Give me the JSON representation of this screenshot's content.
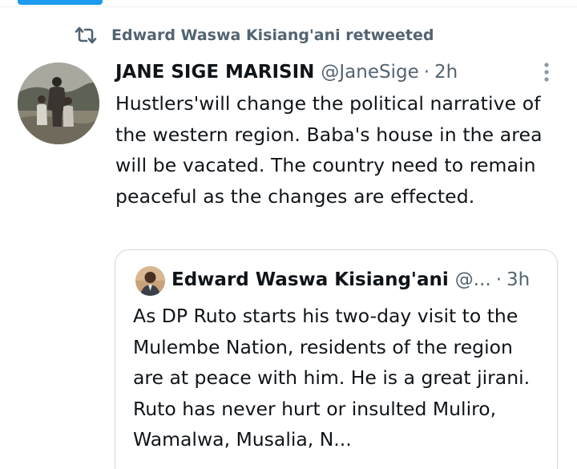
{
  "retweet": {
    "icon": "retweet-icon",
    "text": "Edward Waswa Kisiang'ani retweeted"
  },
  "tweet": {
    "author_name": "JANE SIGE MARISIN",
    "handle": "@JaneSige",
    "separator": "·",
    "time": "2h",
    "text": "Hustlers'will change the political narrative of the western region. Baba's house in the area will be vacated. The country need to remain peaceful as the changes are effected.",
    "more_icon": "more-options-icon"
  },
  "quoted_tweet": {
    "author_name": "Edward Waswa Kisiang'ani",
    "handle": "@...",
    "separator": "·",
    "time": "3h",
    "text": "As DP Ruto starts his two-day visit to the Mulembe Nation, residents of the region are at peace with him. He is a great jirani. Ruto has never hurt or insulted Muliro, Wamalwa, Musalia, N..."
  },
  "colors": {
    "accent": "#1d9bf0",
    "text_primary": "#0f1419",
    "text_secondary": "#536471",
    "border": "#cfd9de"
  }
}
